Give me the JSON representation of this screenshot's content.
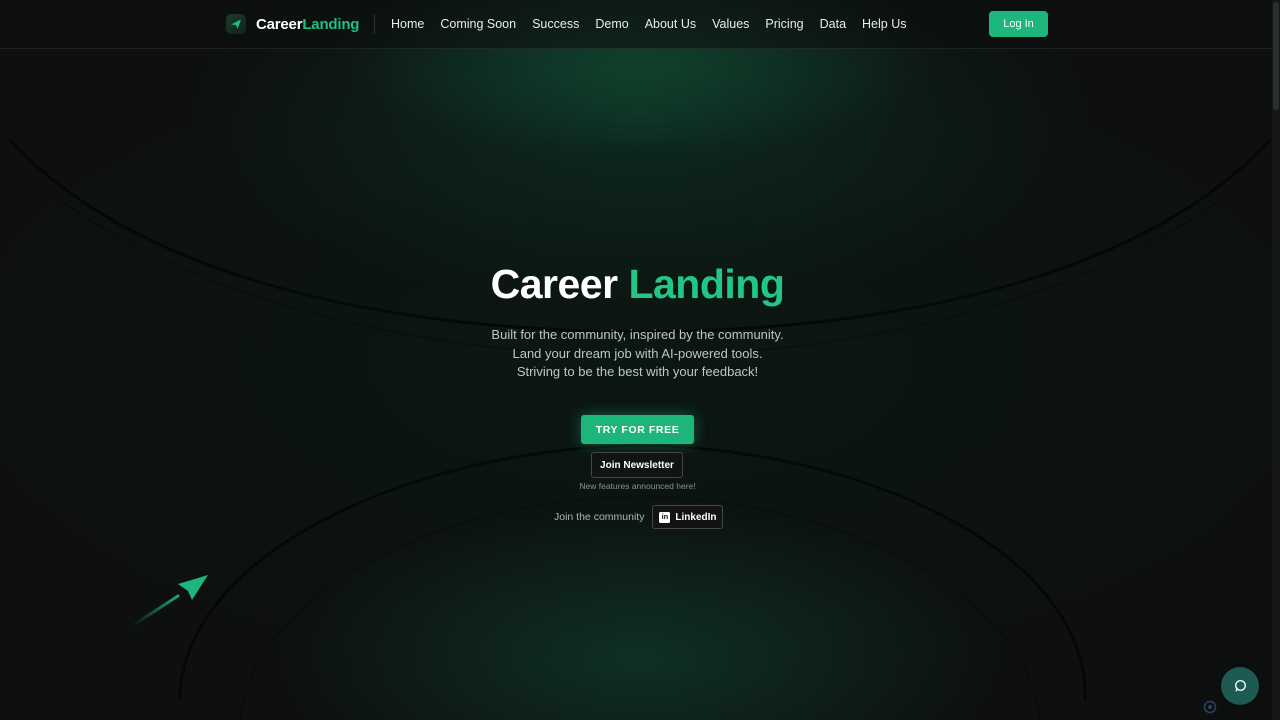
{
  "brand": {
    "name_part1": "Career",
    "name_part2": "Landing",
    "logo_icon": "paper-plane-icon"
  },
  "nav": {
    "links": [
      "Home",
      "Coming Soon",
      "Success",
      "Demo",
      "About Us",
      "Values",
      "Pricing",
      "Data",
      "Help Us"
    ],
    "login_label": "Log In"
  },
  "hero": {
    "title_part1": "Career",
    "title_part2": "Landing",
    "subtitle_lines": [
      "Built for the community, inspired by the community.",
      "Land your dream job with AI-powered tools.",
      "Striving to be the best with your feedback!"
    ],
    "cta_label": "TRY FOR FREE",
    "newsletter_label": "Join Newsletter",
    "newsletter_note": "New features announced here!",
    "community_label": "Join the community",
    "linkedin_label": "LinkedIn",
    "linkedin_icon": "linkedin-icon"
  },
  "widgets": {
    "chat_icon": "chat-bubble-icon",
    "decor_icon": "paper-plane-arrow-icon"
  },
  "colors": {
    "accent": "#1db67c",
    "accent_text": "#22c785",
    "background": "#0d100f",
    "chat_button": "#1d5a52"
  }
}
